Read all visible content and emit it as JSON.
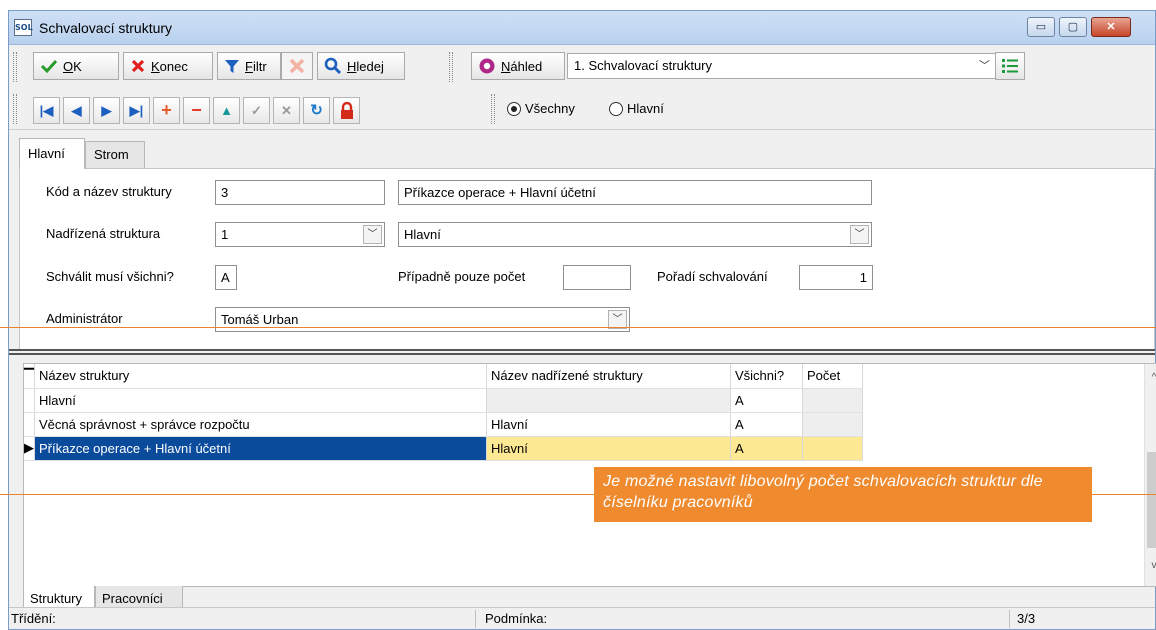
{
  "window": {
    "title": "Schvalovací struktury",
    "logo_text": "SOL",
    "controls": {
      "minimize": "▭",
      "maximize": "▢",
      "close": "✕"
    }
  },
  "toolbar": {
    "ok": {
      "prefix": "",
      "ul": "O",
      "rest": "K"
    },
    "konec": {
      "ul": "K",
      "rest": "onec"
    },
    "filtr": {
      "ul": "F",
      "rest": "iltr"
    },
    "hledej": {
      "ul": "H",
      "rest": "ledej"
    },
    "nahled": {
      "ul": "N",
      "rest": "áhled"
    },
    "view_select": "1. Schvalovací struktury",
    "icons": [
      "check-icon",
      "close-x-icon",
      "filter-icon",
      "clear-filter-icon",
      "search-icon",
      "eye-icon",
      "list-icon"
    ]
  },
  "navigator": {
    "icons": [
      "first-record-icon",
      "prev-record-icon",
      "next-record-icon",
      "last-record-icon",
      "add-icon",
      "delete-icon",
      "up-icon",
      "confirm-icon",
      "cancel-icon",
      "refresh-icon",
      "lock-icon"
    ],
    "radio_all": "Všechny",
    "radio_main": "Hlavní",
    "selected": "Všechny"
  },
  "top_tabs": [
    "Hlavní",
    "Strom"
  ],
  "form": {
    "code_name_label": "Kód a název struktury",
    "code": "3",
    "name": "Příkazce operace + Hlavní účetní",
    "parent_label": "Nadřízená struktura",
    "parent_code": "1",
    "parent_name": "Hlavní",
    "all_must_label": "Schválit musí všichni?",
    "all_must_value": "A",
    "only_count_label": "Případně pouze počet",
    "only_count_value": "",
    "order_label": "Pořadí schvalování",
    "order_value": "1",
    "admin_label": "Administrátor",
    "admin_value": "Tomáš Urban"
  },
  "grid": {
    "columns": [
      "Název struktury",
      "Název nadřízené struktury",
      "Všichni?",
      "Počet"
    ],
    "rows": [
      {
        "name": "Hlavní",
        "parent": "",
        "all": "A",
        "count": ""
      },
      {
        "name": "Věcná správnost + správce rozpočtu",
        "parent": "Hlavní",
        "all": "A",
        "count": ""
      },
      {
        "name": "Příkazce operace + Hlavní účetní",
        "parent": "Hlavní",
        "all": "A",
        "count": ""
      }
    ],
    "scroll_up": "^",
    "scroll_down": "v"
  },
  "bottom_tabs": [
    "Struktury",
    "Pracovníci"
  ],
  "status": {
    "sort_label": "Třídění:",
    "condition_label": "Podmínka:",
    "record_count": "3/3"
  },
  "callout": "Je možné nastavit libovolný počet schvalovacích struktur dle číselníku pracovníků",
  "colors": {
    "accent_orange": "#ef8a2f",
    "selection_blue": "#0b4b9c",
    "highlight_yellow": "#fde993"
  }
}
